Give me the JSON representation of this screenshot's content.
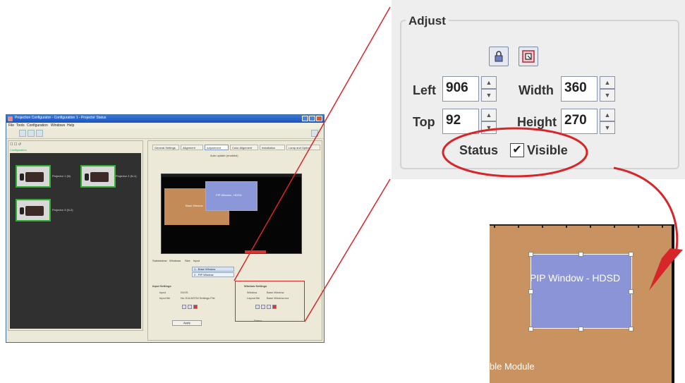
{
  "app": {
    "title": "Projection Configurator - Configuration 1 - Projector Status",
    "menu": [
      "File",
      "Tools",
      "Configuration",
      "Windows",
      "Help"
    ],
    "left_pane_header": "☐ ☐ ↺",
    "left_pane_label": "Configuration",
    "projectors": [
      {
        "label": "Projector 1 (N)"
      },
      {
        "label": "Projector 2 (N-1)"
      },
      {
        "label": "Projector 3 (N-2)"
      }
    ],
    "tabs": [
      "General Settings",
      "Alignment",
      "Adjustment",
      "Color Alignment",
      "Installation",
      "Lamp and Optics"
    ],
    "active_tab": "Adjustment",
    "preview_top_text": "Auto update (enabled)",
    "preview_window_labels": [
      "Base Window",
      "PIP Window - HDSD"
    ],
    "lower_tabs": [
      "Subwindow",
      "Windows",
      "Size",
      "Input"
    ],
    "window_list": [
      "1 - Base Window",
      "2 - PIP Window"
    ],
    "input_settings_title": "Input Settings",
    "input_rows": [
      {
        "key": "Input",
        "value": "DVI/S"
      },
      {
        "key": "Input file",
        "value": "No GUI/ASTM Settings File"
      }
    ],
    "apply_label": "Apply",
    "window_settings_title": "Window Settings",
    "window_rows": [
      {
        "key": "Window",
        "value": "Base Window"
      },
      {
        "key": "Layout file",
        "value": "Base Window.xxx"
      }
    ],
    "status_text": "Status"
  },
  "adjust": {
    "title": "Adjust",
    "left_label": "Left",
    "left_value": "906",
    "width_label": "Width",
    "width_value": "360",
    "top_label": "Top",
    "top_value": "92",
    "height_label": "Height",
    "height_value": "270",
    "status_label": "Status",
    "visible_label": "Visible",
    "visible_checked": true,
    "lock_icon": "lock-icon",
    "fit_icon": "fit-window-icon"
  },
  "pip_preview": {
    "window_label": "PIP Window - HDSD",
    "module_label": "ble Module"
  },
  "colors": {
    "callout_red": "#d7262a",
    "pip_blue": "#8b94d6",
    "canvas_tan": "#c89360",
    "projector_green": "#2fb12f"
  }
}
